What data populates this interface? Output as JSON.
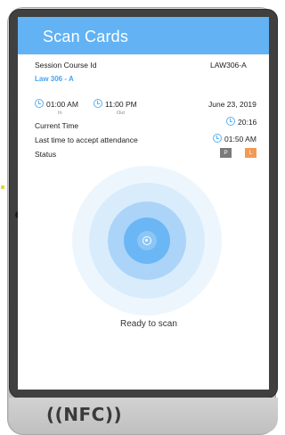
{
  "appbar": {
    "title": "Scan Cards"
  },
  "session": {
    "label": "Session Course Id",
    "course_id": "LAW306-A",
    "course_name": "Law 306 - A"
  },
  "times": {
    "in_time": "01:00 AM",
    "in_label": "In",
    "out_time": "11:00 PM",
    "out_label": "Out",
    "date": "June 23, 2019"
  },
  "current_time": {
    "label": "Current Time",
    "value": "20:16"
  },
  "last_accept": {
    "label": "Last time to accept attendance",
    "value": "01:50 AM"
  },
  "status": {
    "label": "Status",
    "badges": [
      {
        "text": "P",
        "color": "#7a7a7a"
      },
      {
        "text": "L",
        "color": "#f29a55"
      }
    ]
  },
  "scanner": {
    "message": "Ready to scan"
  },
  "device": {
    "logo": "((NFC))"
  },
  "colors": {
    "accent": "#62b2f4",
    "ring_primary": "#6bb6f4"
  },
  "icons": {
    "clock": "clock-icon",
    "nfc": "nfc-icon"
  }
}
